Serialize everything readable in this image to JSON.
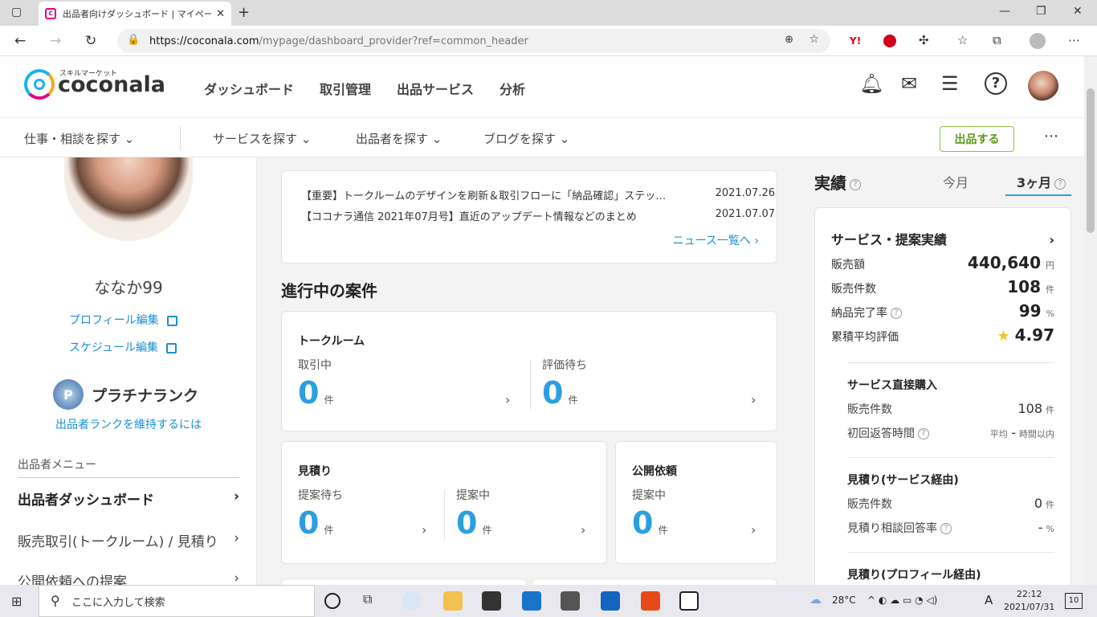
{
  "browser": {
    "tab_title": "出品者向けダッシュボード | マイページ",
    "url_host": "https://coconala.com",
    "url_path": "/mypage/dashboard_provider?ref=common_header"
  },
  "site": {
    "logo_text": "coconala",
    "logo_sub": "スキルマーケット",
    "nav": [
      "ダッシュボード",
      "取引管理",
      "出品サービス",
      "分析"
    ],
    "subnav": [
      "仕事・相談を探す",
      "サービスを探す",
      "出品者を探す",
      "ブログを探す"
    ],
    "sell_button": "出品する"
  },
  "profile": {
    "username": "ななか99",
    "edit_profile": "プロフィール編集",
    "edit_schedule": "スケジュール編集",
    "rank_badge": "P",
    "rank_name": "プラチナランク",
    "rank_link": "出品者ランクを維持するには",
    "menu_header": "出品者メニュー",
    "menu": [
      "出品者ダッシュボード",
      "販売取引(トークルーム) / 見積り",
      "公開依頼への提案"
    ]
  },
  "news": {
    "items": [
      {
        "title": "【重要】トークルームのデザインを刷新＆取引フローに「納品確認」ステップ追加",
        "date": "2021.07.26"
      },
      {
        "title": "【ココナラ通信 2021年07月号】直近のアップデート情報などのまとめ",
        "date": "2021.07.07"
      }
    ],
    "all_link": "ニュース一覧へ"
  },
  "progress": {
    "title": "進行中の案件",
    "talkroom": {
      "title": "トークルーム",
      "cells": [
        {
          "label": "取引中",
          "value": "0",
          "unit": "件"
        },
        {
          "label": "評価待ち",
          "value": "0",
          "unit": "件"
        }
      ]
    },
    "estimate": {
      "title": "見積り",
      "cells": [
        {
          "label": "提案待ち",
          "value": "0",
          "unit": "件"
        },
        {
          "label": "提案中",
          "value": "0",
          "unit": "件"
        }
      ]
    },
    "public": {
      "title": "公開依頼",
      "cells": [
        {
          "label": "提案中",
          "value": "0",
          "unit": "件"
        }
      ]
    }
  },
  "results": {
    "title": "実績",
    "tabs": [
      "今月",
      "3ヶ月"
    ],
    "card_title": "サービス・提案実績",
    "rows": [
      {
        "label": "販売額",
        "value": "440,640",
        "unit": "円"
      },
      {
        "label": "販売件数",
        "value": "108",
        "unit": "件"
      },
      {
        "label": "納品完了率",
        "value": "99",
        "unit": "%"
      },
      {
        "label": "累積平均評価",
        "value": "4.97",
        "unit": ""
      }
    ],
    "direct": {
      "title": "サービス直接購入",
      "rows": [
        {
          "label": "販売件数",
          "value": "108",
          "unit": "件"
        },
        {
          "label": "初回返答時間",
          "prefix": "平均",
          "value": "-",
          "unit": "時間以内"
        }
      ]
    },
    "estimate_service": {
      "title": "見積り(サービス経由)",
      "rows": [
        {
          "label": "販売件数",
          "value": "0",
          "unit": "件"
        },
        {
          "label": "見積り相談回答率",
          "value": "-",
          "unit": "%"
        }
      ]
    },
    "estimate_profile": {
      "title": "見積り(プロフィール経由)"
    }
  },
  "taskbar": {
    "search_placeholder": "ここに入力して検索",
    "weather": "28°C",
    "ime": "A",
    "time": "22:12",
    "date": "2021/07/31",
    "notifications": "10"
  },
  "colors": {
    "accent": "#2c9fe0",
    "link": "#1a8fd6",
    "sell": "#8bc34a"
  }
}
